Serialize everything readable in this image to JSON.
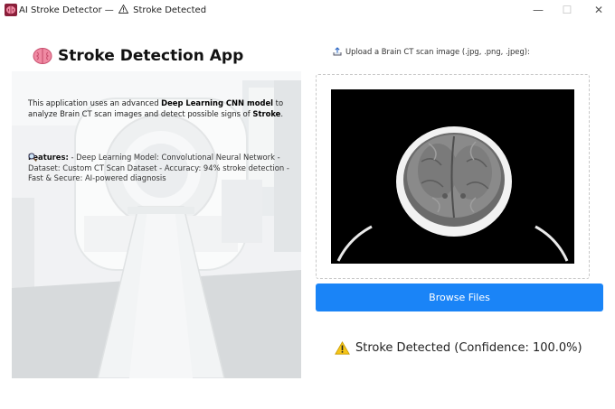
{
  "window": {
    "app_name": "AI Stroke Detector",
    "separator": "—",
    "status": "Stroke Detected",
    "min_glyph": "—",
    "max_glyph": "☐",
    "close_glyph": "✕"
  },
  "header": {
    "title": "Stroke Detection App",
    "icon": "brain-icon"
  },
  "description": {
    "text_before": "This application uses an advanced ",
    "bold_model": "Deep Learning CNN model",
    "text_middle": " to analyze Brain CT scan images and detect possible signs of ",
    "bold_stroke": "Stroke",
    "text_end": "."
  },
  "features": {
    "icon": "magnifier-icon",
    "label": "Features:",
    "text": " - Deep Learning Model: Convolutional Neural Network - Dataset: Custom CT Scan Dataset - Accuracy: 94% stroke detection - Fast & Secure: AI-powered diagnosis"
  },
  "upload": {
    "label": "Upload a Brain CT scan image (.jpg, .png, .jpeg):",
    "icon": "upload-tray-icon",
    "button_label": "Browse Files"
  },
  "result": {
    "icon": "warning-icon",
    "text": "Stroke Detected (Confidence: 100.0%)"
  },
  "colors": {
    "accent": "#1a84f7",
    "warning": "#f5c518",
    "brain": "#e8698a"
  }
}
